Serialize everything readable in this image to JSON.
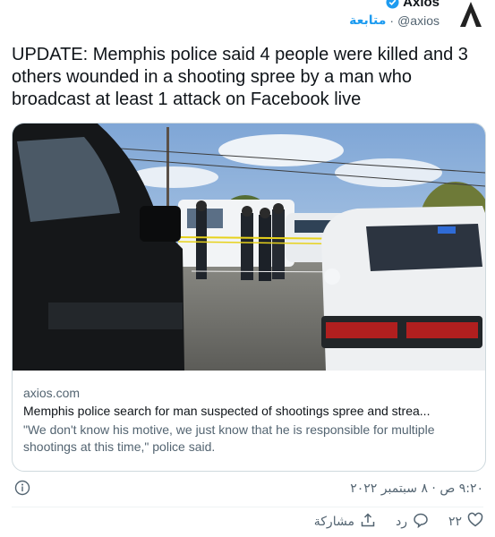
{
  "header": {
    "display_name": "Axios",
    "handle": "@axios",
    "separator": "·",
    "follow_label": "متابعة"
  },
  "tweet": {
    "text": "UPDATE: Memphis police said 4 people were killed and 3 others wounded in a shooting spree by a man who broadcast at least 1 attack on Facebook live"
  },
  "card": {
    "domain": "axios.com",
    "title": "Memphis police search for man suspected of shootings spree and strea...",
    "description": "\"We don't know his motive, we just know that he is responsible for multiple shootings at this time,\" police said."
  },
  "timestamp": "٩:٢٠ ص · ٨ سبتمبر ٢٠٢٢",
  "actions": {
    "like_count": "٢٢",
    "reply_label": "رد",
    "share_label": "مشاركة"
  },
  "colors": {
    "accent": "#1d9bf0",
    "secondary_text": "#536471",
    "border": "#cfd9de"
  },
  "icons": [
    "axios-logo-icon",
    "verified-badge-icon",
    "info-icon",
    "heart-icon",
    "reply-icon",
    "share-icon"
  ]
}
